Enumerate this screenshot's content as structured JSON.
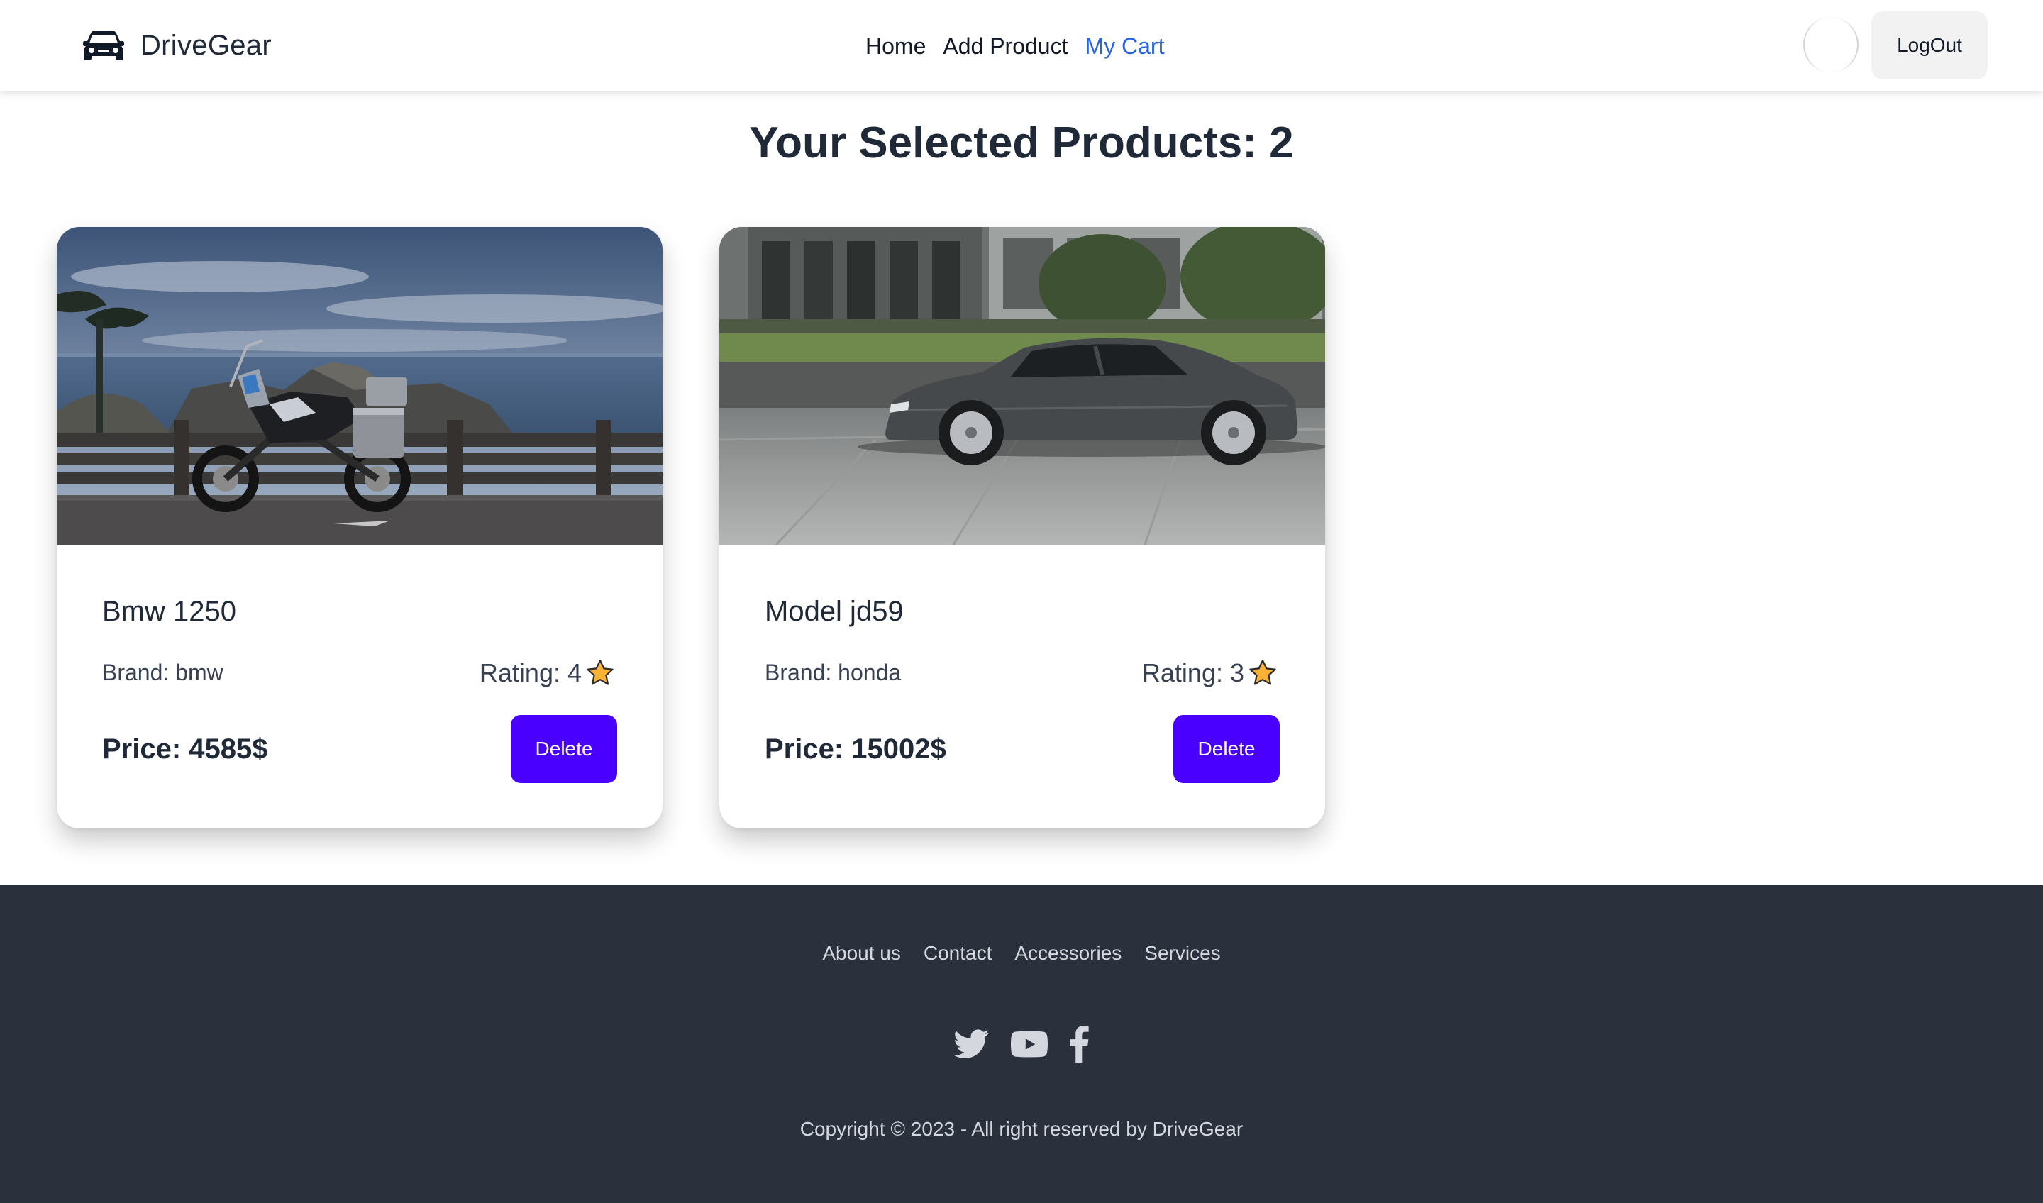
{
  "navbar": {
    "brand_name": "DriveGear",
    "brand_icon": "car-icon",
    "links": [
      {
        "label": "Home",
        "active": false
      },
      {
        "label": "Add Product",
        "active": false
      },
      {
        "label": "My Cart",
        "active": true
      }
    ],
    "logout_label": "LogOut"
  },
  "page": {
    "heading": "Your Selected Products: 2"
  },
  "products": [
    {
      "title": "Bmw 1250",
      "brand": "Brand: bmw",
      "rating_label": "Rating: 4",
      "price": "Price: 4585$",
      "delete_label": "Delete",
      "image": "motorcycle-by-the-sea-photo"
    },
    {
      "title": "Model jd59",
      "brand": "Brand: honda",
      "rating_label": "Rating: 3",
      "price": "Price: 15002$",
      "delete_label": "Delete",
      "image": "gray-sedan-in-motion-photo"
    }
  ],
  "footer": {
    "links": [
      "About us",
      "Contact",
      "Accessories",
      "Services"
    ],
    "social": [
      "twitter-icon",
      "youtube-icon",
      "facebook-icon"
    ],
    "copyright": "Copyright © 2023 - All right reserved by DriveGear"
  },
  "colors": {
    "accent": "#4a00ff",
    "active_link": "#2563eb",
    "footer_bg": "#2a303c",
    "text_dark": "#1f2937",
    "star": "#f9b233"
  }
}
